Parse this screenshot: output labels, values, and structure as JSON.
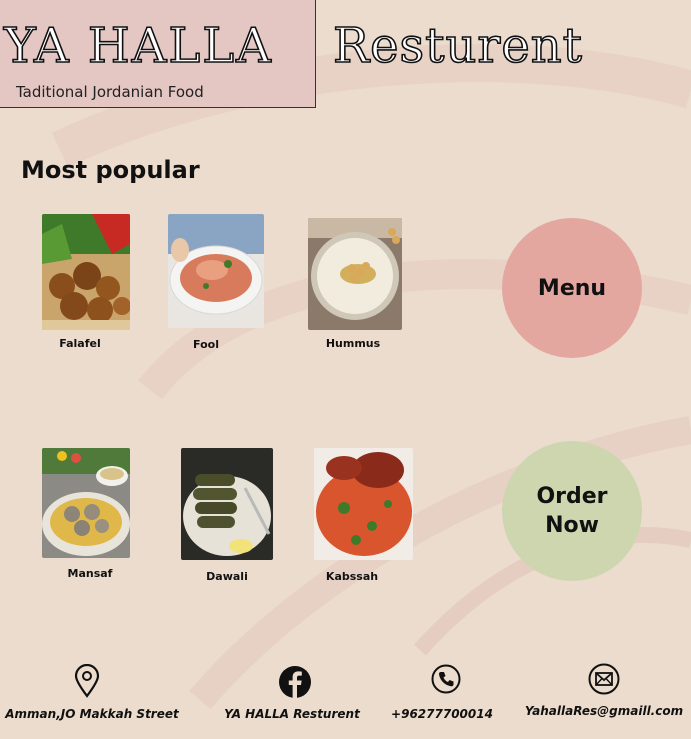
{
  "header": {
    "brand_name": "YA HALLA",
    "tagline": "Taditional Jordanian Food",
    "restaurant_word": "Resturent"
  },
  "section": {
    "title": "Most popular"
  },
  "dishes": [
    {
      "name": "Falafel",
      "icon": "falafel-photo"
    },
    {
      "name": "Fool",
      "icon": "fool-photo"
    },
    {
      "name": "Hummus",
      "icon": "hummus-photo"
    },
    {
      "name": "Mansaf",
      "icon": "mansaf-photo"
    },
    {
      "name": "Dawali",
      "icon": "dawali-photo"
    },
    {
      "name": "Kabssah",
      "icon": "kabssah-photo"
    }
  ],
  "actions": {
    "menu_label": "Menu",
    "order_line1": "Order",
    "order_line2": "Now"
  },
  "footer": {
    "address": "Amman,JO Makkah Street",
    "facebook": "YA HALLA Resturent",
    "phone": "+96277700014",
    "email": "YahallaRes@gmaill.com"
  },
  "colors": {
    "background": "#ecdccd",
    "brand_box": "#e4c6c3",
    "menu_circle": "#e3a7a0",
    "order_circle": "#ced6b0"
  }
}
